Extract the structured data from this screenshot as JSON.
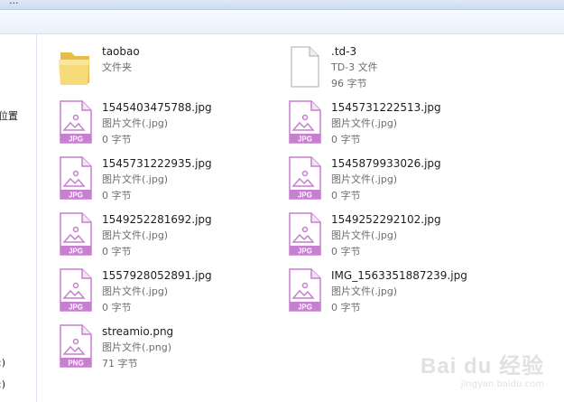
{
  "window": {
    "title_fragment": "..."
  },
  "sidebar": {
    "items": [
      {
        "label": "位置"
      },
      {
        "label": ":)"
      },
      {
        "label": ":)"
      }
    ]
  },
  "files": [
    {
      "name": "taobao",
      "type": "文件夹",
      "size": "",
      "icon": "folder-icon"
    },
    {
      "name": ".td-3",
      "type": "TD-3 文件",
      "size": "96 字节",
      "icon": "blank-file-icon"
    },
    {
      "name": "1545403475788.jpg",
      "type": "图片文件(.jpg)",
      "size": "0 字节",
      "icon": "jpg-file-icon",
      "badge": "JPG"
    },
    {
      "name": "1545731222513.jpg",
      "type": "图片文件(.jpg)",
      "size": "0 字节",
      "icon": "jpg-file-icon",
      "badge": "JPG"
    },
    {
      "name": "1545731222935.jpg",
      "type": "图片文件(.jpg)",
      "size": "0 字节",
      "icon": "jpg-file-icon",
      "badge": "JPG"
    },
    {
      "name": "1545879933026.jpg",
      "type": "图片文件(.jpg)",
      "size": "0 字节",
      "icon": "jpg-file-icon",
      "badge": "JPG"
    },
    {
      "name": "1549252281692.jpg",
      "type": "图片文件(.jpg)",
      "size": "0 字节",
      "icon": "jpg-file-icon",
      "badge": "JPG"
    },
    {
      "name": "1549252292102.jpg",
      "type": "图片文件(.jpg)",
      "size": "0 字节",
      "icon": "jpg-file-icon",
      "badge": "JPG"
    },
    {
      "name": "1557928052891.jpg",
      "type": "图片文件(.jpg)",
      "size": "0 字节",
      "icon": "jpg-file-icon",
      "badge": "JPG"
    },
    {
      "name": "IMG_1563351887239.jpg",
      "type": "图片文件(.jpg)",
      "size": "0 字节",
      "icon": "jpg-file-icon",
      "badge": "JPG"
    },
    {
      "name": "streamio.png",
      "type": "图片文件(.png)",
      "size": "71 字节",
      "icon": "png-file-icon",
      "badge": "PNG"
    }
  ],
  "watermark": {
    "brand": "Bai du 经验",
    "url": "jingyan.baidu.com"
  },
  "colors": {
    "image_icon_accent": "#c77fcf",
    "folder": "#f0cd62",
    "selection_border": "#dbe4f0"
  }
}
